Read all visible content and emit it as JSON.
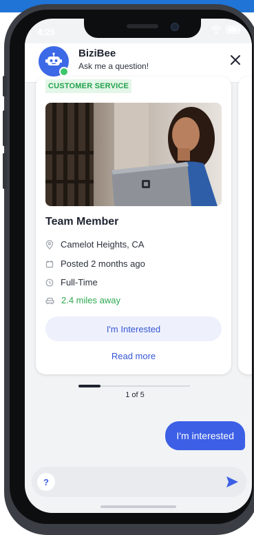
{
  "status_bar": {
    "time": "4:25"
  },
  "header": {
    "bot_name": "BiziBee",
    "bot_subtitle": "Ask me a question!"
  },
  "job": {
    "tag": "CUSTOMER SERVICE",
    "title": "Team Member",
    "location": "Camelot Heights, CA",
    "posted": "Posted 2 months ago",
    "type": "Full-Time",
    "distance": "2.4 miles away",
    "interested_label": "I'm Interested",
    "read_more_label": "Read more"
  },
  "pagination": {
    "label": "1 of 5",
    "current": 1,
    "total": 5
  },
  "messages": [
    {
      "from": "user",
      "text": "I'm interested"
    }
  ],
  "input": {
    "help_label": "?",
    "placeholder": ""
  },
  "colors": {
    "accent": "#3c5fe6",
    "tag_green": "#22a24b",
    "tag_bg": "#e3f6e8",
    "button_bg": "#eef1fc",
    "top_band": "#1f74d6"
  },
  "icons": [
    "robot-icon",
    "close-icon",
    "location-pin-icon",
    "calendar-icon",
    "clock-icon",
    "car-icon",
    "send-icon",
    "wifi-icon",
    "battery-icon"
  ]
}
